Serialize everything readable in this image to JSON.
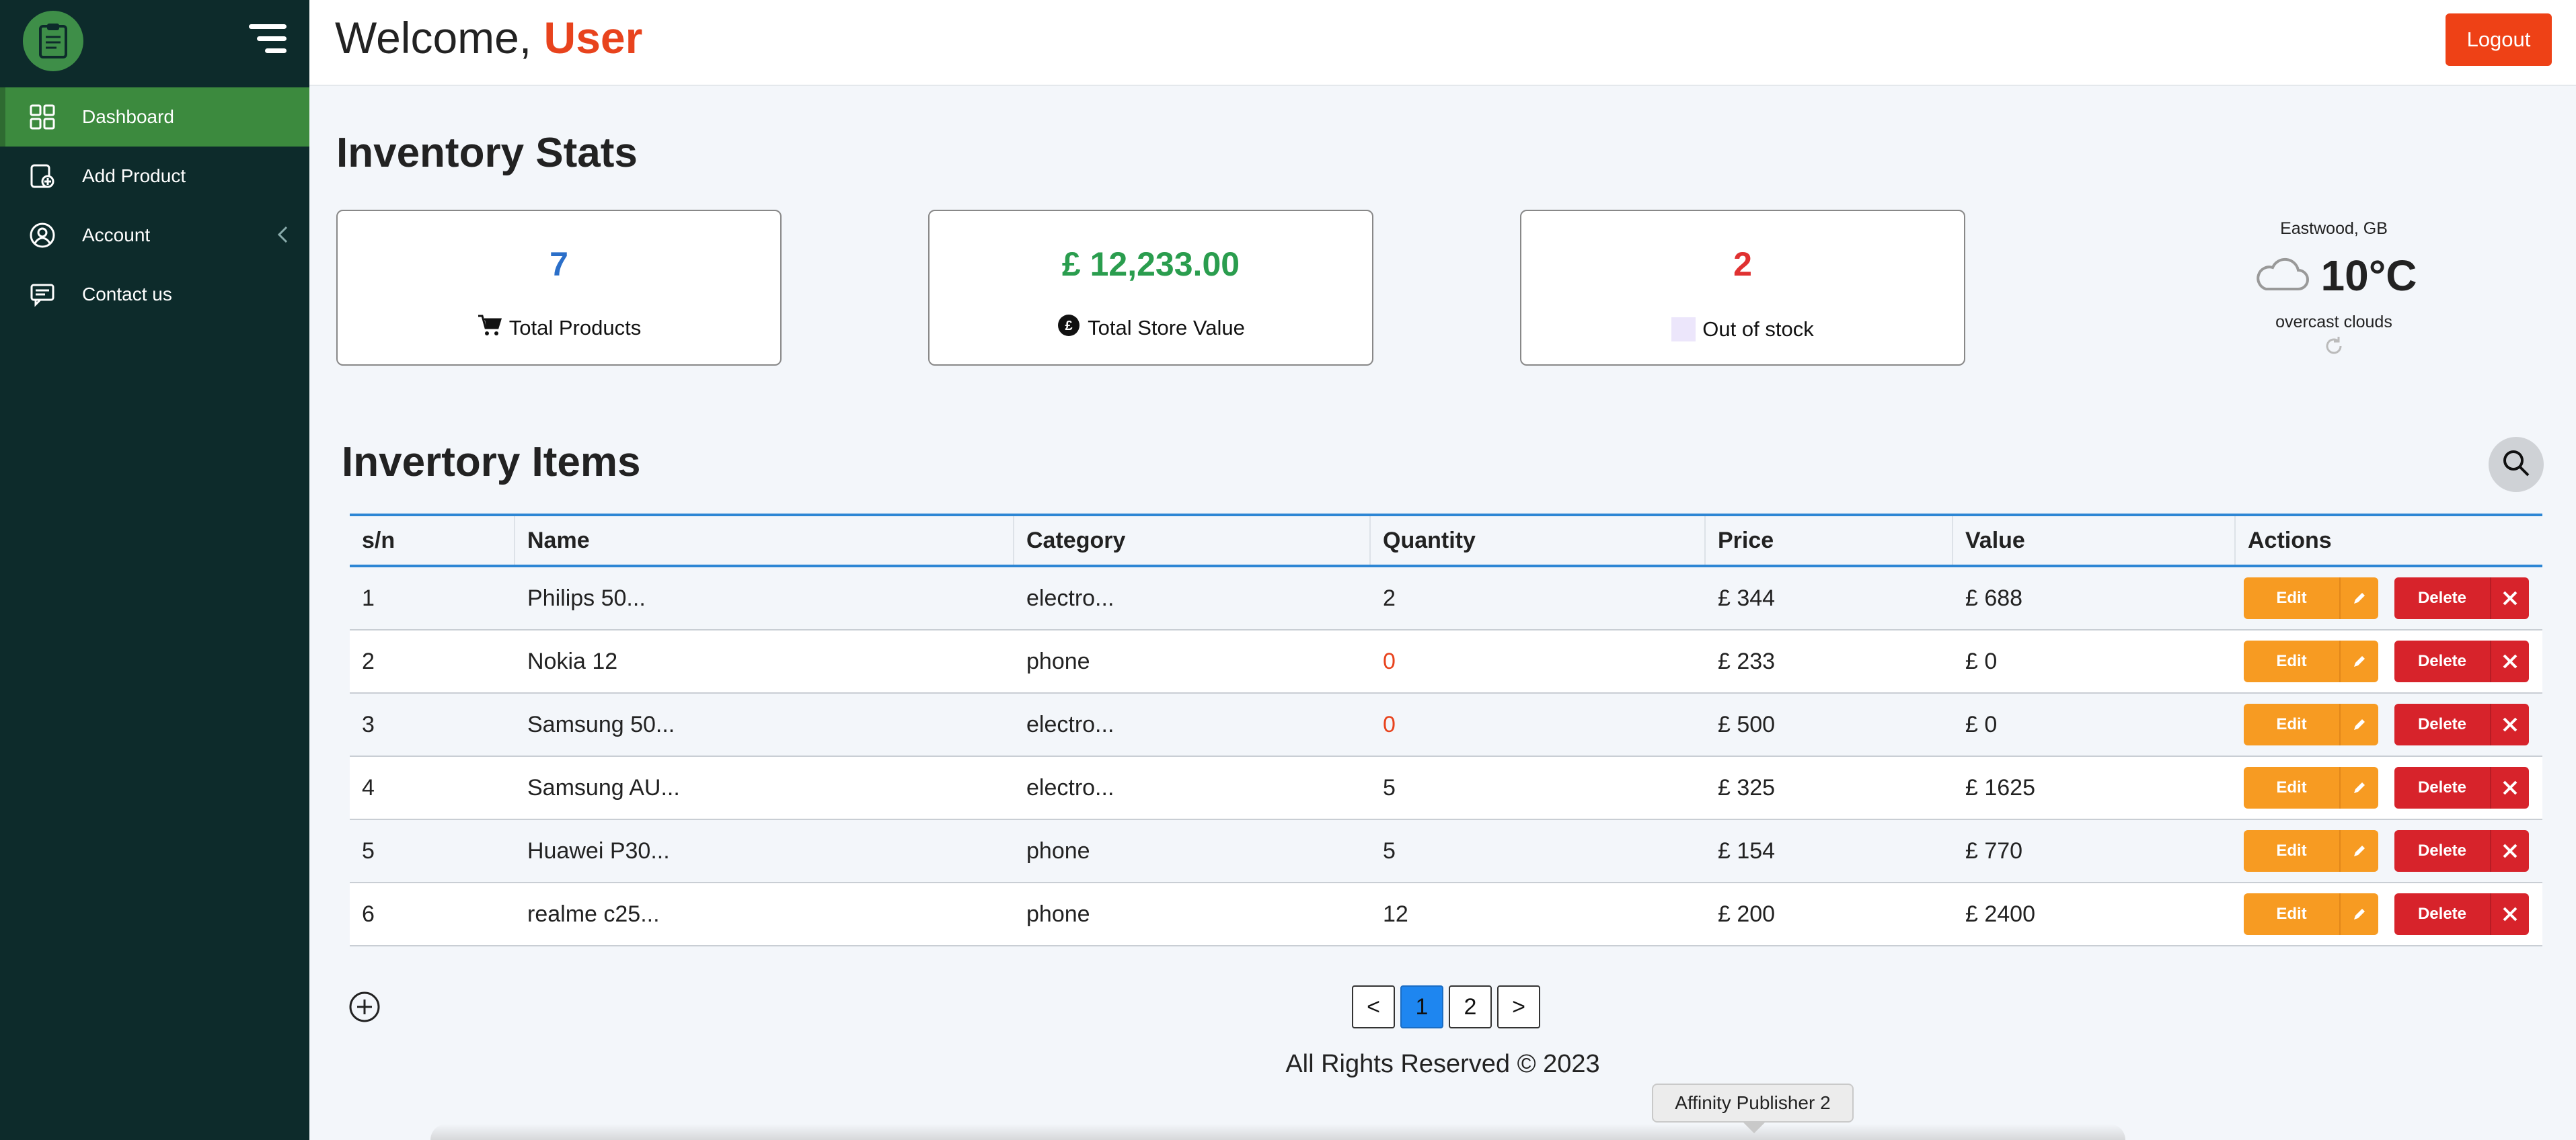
{
  "sidebar": {
    "items": [
      {
        "label": "Dashboard",
        "icon": "grid-icon",
        "active": true
      },
      {
        "label": "Add Product",
        "icon": "add-product-icon"
      },
      {
        "label": "Account",
        "icon": "user-circle-icon"
      },
      {
        "label": "Contact us",
        "icon": "chat-icon"
      }
    ]
  },
  "header": {
    "welcome": "Welcome,",
    "user": "User",
    "logout_label": "Logout"
  },
  "stats": {
    "title": "Inventory Stats",
    "cards": [
      {
        "value": "7",
        "label": "Total Products",
        "icon": "cart-icon",
        "color": "#2b6fc9"
      },
      {
        "value": "£ 12,233.00",
        "label": "Total Store Value",
        "icon": "pound-coin-icon",
        "color": "#2a9d4e"
      },
      {
        "value": "2",
        "label": "Out of stock",
        "icon": "color-swatch",
        "color": "#e03131"
      }
    ]
  },
  "weather": {
    "location": "Eastwood, GB",
    "temperature": "10°C",
    "description": "overcast clouds"
  },
  "inventory": {
    "title": "Invertory Items",
    "columns": [
      "s/n",
      "Name",
      "Category",
      "Quantity",
      "Price",
      "Value",
      "Actions"
    ],
    "rows": [
      [
        "1",
        "Philips 50...",
        "electro...",
        "2",
        "£ 344",
        "£ 688"
      ],
      [
        "2",
        "Nokia 12",
        "phone",
        "0",
        "£ 233",
        "£ 0"
      ],
      [
        "3",
        "Samsung 50...",
        "electro...",
        "0",
        "£ 500",
        "£ 0"
      ],
      [
        "4",
        "Samsung AU...",
        "electro...",
        "5",
        "£ 325",
        "£ 1625"
      ],
      [
        "5",
        "Huawei P30...",
        "phone",
        "5",
        "£ 154",
        "£ 770"
      ],
      [
        "6",
        "realme c25...",
        "phone",
        "12",
        "£ 200",
        "£ 2400"
      ]
    ],
    "edit_label": "Edit",
    "delete_label": "Delete"
  },
  "pagination": {
    "prev": "<",
    "pages": [
      "1",
      "2"
    ],
    "current": "1",
    "next": ">"
  },
  "footer": "All Rights Reserved © 2023",
  "tooltip": "Affinity Publisher 2",
  "colors": {
    "sidebar_bg": "#0d2b2b",
    "active_nav": "#3c8a3e",
    "accent_red": "#ee4116",
    "edit_orange": "#f79b22",
    "delete_red": "#d7232b",
    "table_border_blue": "#2d86d4"
  }
}
